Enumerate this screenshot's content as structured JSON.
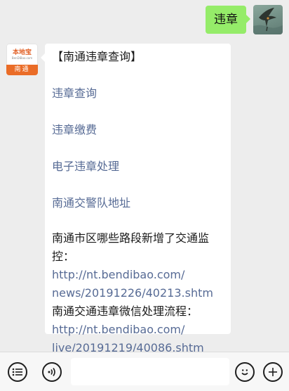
{
  "outgoing": {
    "text": "违章"
  },
  "bot": {
    "avatar_brand": "本地宝",
    "avatar_domain": "BenDiBao.com",
    "avatar_city": "南通"
  },
  "reply": {
    "title": "【南通违章查询】",
    "menu": [
      "违章查询",
      "违章缴费",
      "电子违章处理",
      "南通交警队地址"
    ],
    "info": [
      {
        "label": "南通市区哪些路段新增了交通监控：",
        "link_lines": [
          "http://nt.bendibao.com/",
          "news/20191226/40213.shtm"
        ]
      },
      {
        "label": "南通交通违章微信处理流程：",
        "link_lines": [
          "http://nt.bendibao.com/",
          "live/20191219/40086.shtm"
        ]
      }
    ]
  },
  "toolbar": {
    "icons": [
      "menu-list-icon",
      "voice-icon",
      "emoji-icon",
      "plus-icon"
    ],
    "input_value": ""
  },
  "colors": {
    "outgoing_bubble": "#95ec69",
    "link": "#576b95",
    "brand_orange": "#ea6c27",
    "background": "#ededed"
  }
}
